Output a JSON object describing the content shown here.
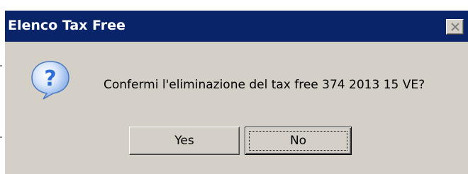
{
  "window": {
    "title": "Elenco Tax Free",
    "close_icon": "close-icon"
  },
  "dialog": {
    "icon": "question-icon",
    "message": "Confermi l'eliminazione del tax free 374 2013 15 VE?",
    "buttons": [
      {
        "label": "Yes"
      },
      {
        "label": "No",
        "default": true
      }
    ]
  },
  "colors": {
    "titlebar": "#0a246a",
    "dialog_bg": "#d4d0c8",
    "icon_blue": "#2f6fd6"
  }
}
